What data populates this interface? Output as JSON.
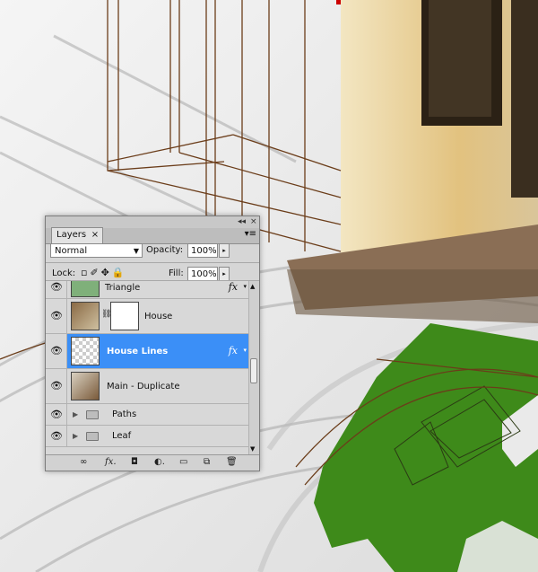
{
  "panel": {
    "tab_label": "Layers",
    "tab_close": "×",
    "collapse_glyph": "◂◂",
    "close_glyph": "×",
    "menu_glyph": "▾≡",
    "blend_mode": "Normal",
    "opacity_label": "Opacity:",
    "opacity_value": "100%",
    "lock_label": "Lock:",
    "lock_icons": "▫✐✥🔒",
    "fill_label": "Fill:",
    "fill_value": "100%",
    "stepper_glyph": "▸"
  },
  "layers": [
    {
      "name": "Triangle",
      "fx": "fx",
      "visible": true
    },
    {
      "name": "House",
      "fx": "",
      "visible": true
    },
    {
      "name": "House Lines",
      "fx": "fx",
      "visible": true,
      "selected": true
    },
    {
      "name": "Main - Duplicate",
      "fx": "",
      "visible": true
    },
    {
      "name": "Paths",
      "type": "group",
      "visible": true
    },
    {
      "name": "Leaf",
      "type": "group",
      "visible": true
    }
  ],
  "icons": {
    "eye": "👁",
    "chain": "⛓",
    "expand": "▶",
    "fx_arrow": "▾"
  },
  "bottom_bar": {
    "link": "∞",
    "fx": "fx.",
    "mask": "◘",
    "adjust": "◐.",
    "group": "▭",
    "new": "⧉",
    "trash": "🗑"
  },
  "colors": {
    "selection": "#3b8ff7",
    "leaf_green": "#3e8a1a",
    "wood": "#e6c98e",
    "line_brown": "#6b3d1a"
  }
}
